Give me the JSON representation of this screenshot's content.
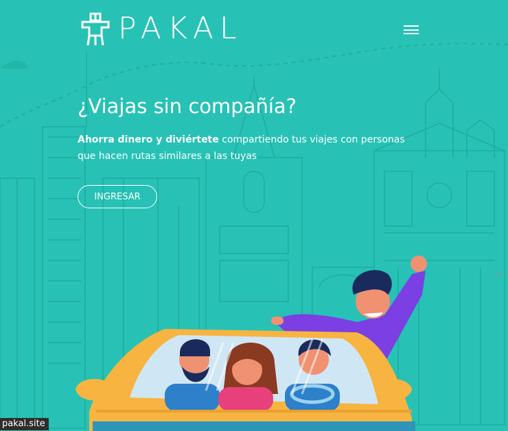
{
  "brand": {
    "name": "PAKAL"
  },
  "header": {
    "menu_icon": "hamburger-icon"
  },
  "hero": {
    "title": "¿Viajas sin compañía?",
    "lead_bold": "Ahorra dinero y diviértete",
    "lead_rest": " compartiendo tus viajes con personas que hacen rutas similares a las tuyas",
    "cta_label": "INGRESAR"
  },
  "status": {
    "site": "pakal.site"
  },
  "colors": {
    "background": "#27c2b5",
    "car": "#f7b440",
    "shirt_purple": "#7b3fe4",
    "outline": "#1ea79b"
  }
}
